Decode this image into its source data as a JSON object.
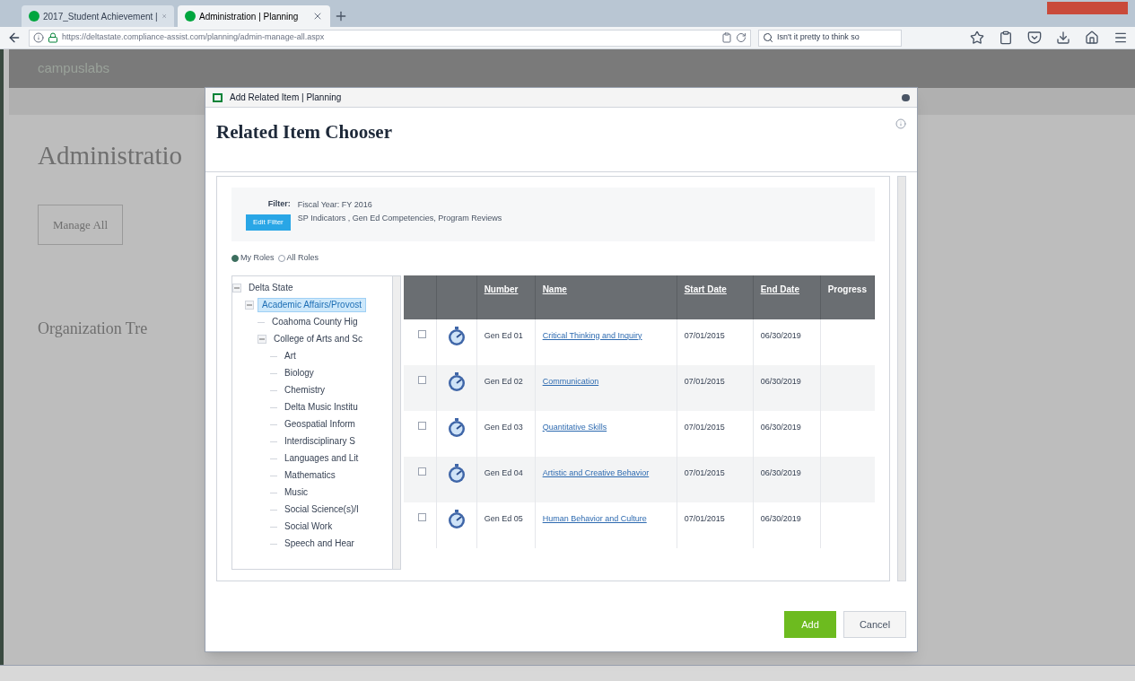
{
  "browser": {
    "tabs": [
      {
        "label": "2017_Student Achievement |",
        "selected": false
      },
      {
        "label": "Administration | Planning",
        "selected": true
      }
    ],
    "url": "https://deltastate.compliance-assist.com/planning/admin-manage-all.aspx",
    "search": "Isn't it pretty to think so"
  },
  "page": {
    "logo": "campuslabs",
    "heading": "Administratio",
    "tab": "Manage All",
    "section": "Organization Tre"
  },
  "dialog": {
    "title": "Add Related Item | Planning",
    "heading": "Related Item Chooser",
    "filter": {
      "label": "Filter:",
      "lines": [
        "Fiscal Year: FY 2016",
        "SP Indicators , Gen Ed Competencies, Program Reviews"
      ],
      "button": "Edit Filter"
    },
    "roles": [
      {
        "label": "My Roles",
        "selected": true
      },
      {
        "label": "All Roles",
        "selected": false
      }
    ],
    "tree": [
      {
        "label": "Delta State",
        "expanded": true,
        "selected": false,
        "children": [
          {
            "label": "Academic Affairs/Provost",
            "expanded": true,
            "selected": true,
            "children": [
              {
                "label": "Coahoma County Hig"
              },
              {
                "label": "College of Arts and Sc",
                "expanded": true,
                "selected": false,
                "children": [
                  {
                    "label": "Art"
                  },
                  {
                    "label": "Biology"
                  },
                  {
                    "label": "Chemistry"
                  },
                  {
                    "label": "Delta Music Institu"
                  },
                  {
                    "label": "Geospatial Inform"
                  },
                  {
                    "label": "Interdisciplinary S"
                  },
                  {
                    "label": "Languages and Lit"
                  },
                  {
                    "label": "Mathematics"
                  },
                  {
                    "label": "Music"
                  },
                  {
                    "label": "Social Science(s)/I"
                  },
                  {
                    "label": "Social Work"
                  },
                  {
                    "label": "Speech and Hear"
                  }
                ]
              }
            ]
          }
        ]
      }
    ],
    "table": {
      "columns": [
        "Number",
        "Name",
        "Start Date",
        "End Date",
        "Progress"
      ],
      "rows": [
        {
          "checked": false,
          "number": "Gen Ed 01",
          "name": "Critical Thinking and Inquiry",
          "start": "07/01/2015",
          "end": "06/30/2019"
        },
        {
          "checked": false,
          "number": "Gen Ed 02",
          "name": "Communication",
          "start": "07/01/2015",
          "end": "06/30/2019"
        },
        {
          "checked": false,
          "number": "Gen Ed 03",
          "name": "Quantitative Skills",
          "start": "07/01/2015",
          "end": "06/30/2019"
        },
        {
          "checked": false,
          "number": "Gen Ed 04",
          "name": "Artistic and Creative Behavior",
          "start": "07/01/2015",
          "end": "06/30/2019"
        },
        {
          "checked": false,
          "number": "Gen Ed 05",
          "name": "Human Behavior and Culture",
          "start": "07/01/2015",
          "end": "06/30/2019"
        }
      ]
    },
    "buttons": [
      "Add",
      "Cancel"
    ]
  }
}
